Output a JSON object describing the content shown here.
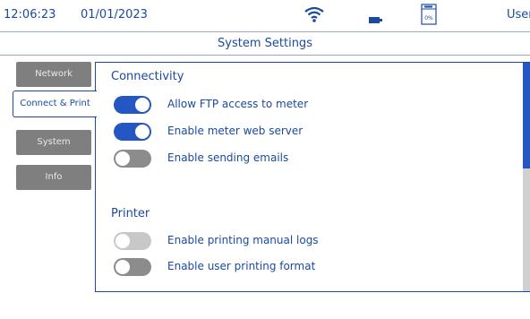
{
  "status": {
    "time": "12:06:23",
    "date": "01/01/2023",
    "disk_percent": "0%",
    "user_label": "User",
    "icons": [
      "wifi-icon",
      "battery-icon",
      "storage-icon"
    ]
  },
  "title": "System Settings",
  "tabs": [
    {
      "label": "Network",
      "active": false
    },
    {
      "label": "Connect & Print",
      "active": true
    },
    {
      "label": "System",
      "active": false
    },
    {
      "label": "Info",
      "active": false
    }
  ],
  "sections": {
    "connectivity": {
      "title": "Connectivity",
      "options": [
        {
          "label": "Allow FTP access to meter",
          "state": "on"
        },
        {
          "label": "Enable meter web server",
          "state": "on"
        },
        {
          "label": "Enable sending emails",
          "state": "off"
        }
      ]
    },
    "printer": {
      "title": "Printer",
      "options": [
        {
          "label": "Enable printing manual logs",
          "state": "disabled"
        },
        {
          "label": "Enable user printing format",
          "state": "off"
        }
      ]
    }
  },
  "colors": {
    "accent": "#2456c4",
    "text": "#1a4aa0",
    "tab_inactive": "#7f7f7f",
    "toggle_off": "#8c8c8c",
    "toggle_disabled": "#c8c8c8",
    "scroll_track": "#d0d0d0"
  }
}
